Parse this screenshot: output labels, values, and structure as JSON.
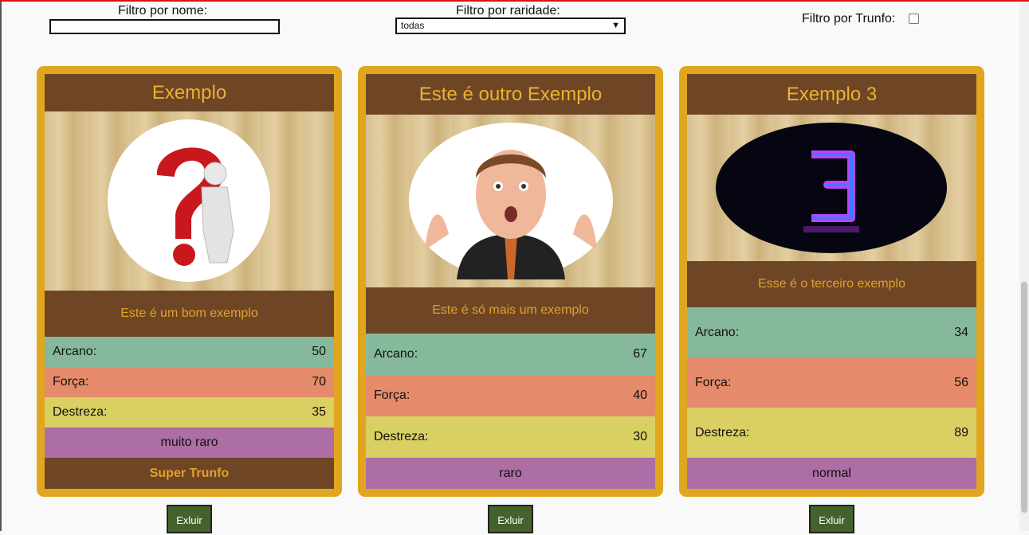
{
  "filters": {
    "name_label": "Filtro por nome:",
    "name_value": "",
    "rarity_label": "Filtro por raridade:",
    "rarity_value": "todas",
    "trunfo_label": "Filtro por Trunfo:",
    "trunfo_checked": false
  },
  "cards": [
    {
      "name": "Exemplo",
      "description": "Este é um bom exemplo",
      "image_icon": "question-mark-figure-icon",
      "arcano_label": "Arcano:",
      "arcano": "50",
      "forca_label": "Força:",
      "forca": "70",
      "destreza_label": "Destreza:",
      "destreza": "35",
      "rarity": "muito raro",
      "trunfo": "Super Trunfo",
      "delete_label": "Exluir"
    },
    {
      "name": "Este é outro Exemplo",
      "description": "Este é só mais um exemplo",
      "image_icon": "surprised-man-icon",
      "arcano_label": "Arcano:",
      "arcano": "67",
      "forca_label": "Força:",
      "forca": "40",
      "destreza_label": "Destreza:",
      "destreza": "30",
      "rarity": "raro",
      "delete_label": "Exluir"
    },
    {
      "name": "Exemplo 3",
      "description": "Esse é o terceiro exemplo",
      "image_icon": "neon-number-three-icon",
      "arcano_label": "Arcano:",
      "arcano": "34",
      "forca_label": "Força:",
      "forca": "56",
      "destreza_label": "Destreza:",
      "destreza": "89",
      "rarity": "normal",
      "delete_label": "Exluir"
    }
  ],
  "colors": {
    "card_border": "#e0a620",
    "title_band": "#6e4626",
    "title_text": "#e9b42d",
    "arcano": "#86b99b",
    "forca": "#e58a6a",
    "destreza": "#d9cf62",
    "raridade": "#ad6ea6",
    "delete_button": "#44632c"
  }
}
